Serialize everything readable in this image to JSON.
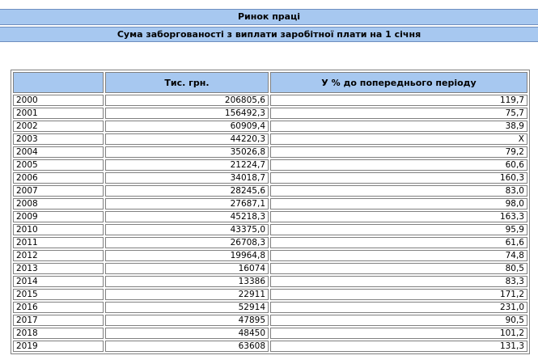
{
  "header": {
    "title": "Ринок праці",
    "subtitle": "Сума заборгованості з виплати заробітної плати на 1 січня"
  },
  "table": {
    "columns": [
      "",
      "Тис. грн.",
      "У % до попереднього періоду"
    ],
    "rows": [
      {
        "year": "2000",
        "value": "206805,6",
        "percent": "119,7"
      },
      {
        "year": "2001",
        "value": "156492,3",
        "percent": "75,7"
      },
      {
        "year": "2002",
        "value": "60909,4",
        "percent": "38,9"
      },
      {
        "year": "2003",
        "value": "44220,3",
        "percent": "X"
      },
      {
        "year": "2004",
        "value": "35026,8",
        "percent": "79,2"
      },
      {
        "year": "2005",
        "value": "21224,7",
        "percent": "60,6"
      },
      {
        "year": "2006",
        "value": "34018,7",
        "percent": "160,3"
      },
      {
        "year": "2007",
        "value": "28245,6",
        "percent": "83,0"
      },
      {
        "year": "2008",
        "value": "27687,1",
        "percent": "98,0"
      },
      {
        "year": "2009",
        "value": "45218,3",
        "percent": "163,3"
      },
      {
        "year": "2010",
        "value": "43375,0",
        "percent": "95,9"
      },
      {
        "year": "2011",
        "value": "26708,3",
        "percent": "61,6"
      },
      {
        "year": "2012",
        "value": "19964,8",
        "percent": "74,8"
      },
      {
        "year": "2013",
        "value": "16074",
        "percent": "80,5"
      },
      {
        "year": "2014",
        "value": "13386",
        "percent": "83,3"
      },
      {
        "year": "2015",
        "value": "22911",
        "percent": "171,2"
      },
      {
        "year": "2016",
        "value": "52914",
        "percent": "231,0"
      },
      {
        "year": "2017",
        "value": "47895",
        "percent": "90,5"
      },
      {
        "year": "2018",
        "value": "48450",
        "percent": "101,2"
      },
      {
        "year": "2019",
        "value": "63608",
        "percent": "131,3"
      }
    ]
  },
  "colors": {
    "header_bg": "#a7c8f0",
    "border": "#808080"
  }
}
